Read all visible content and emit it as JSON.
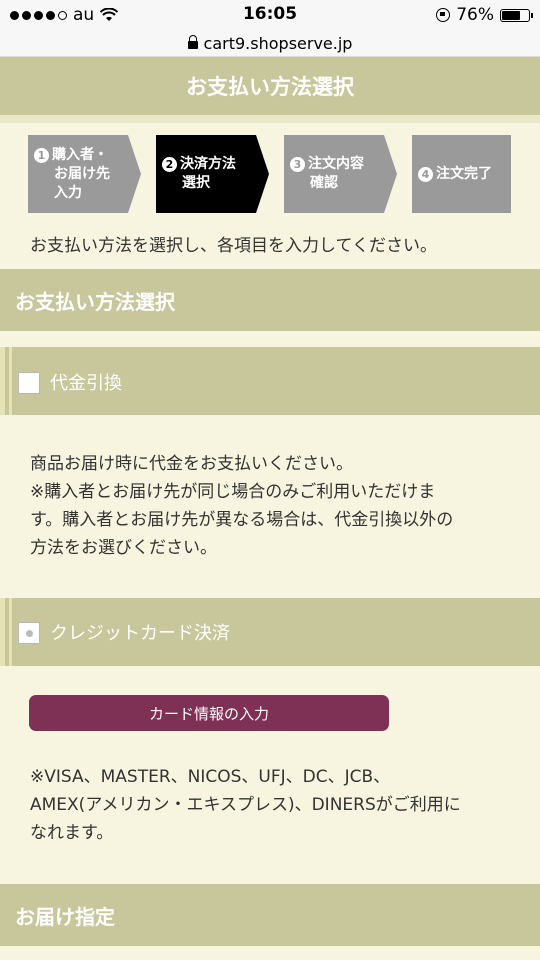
{
  "status": {
    "carrier": "au",
    "time": "16:05",
    "battery": "76%",
    "battery_level": 0.76
  },
  "browser": {
    "url": "cart9.shopserve.jp"
  },
  "page": {
    "title": "お支払い方法選択",
    "intro": "お支払い方法を選択し、各項目を入力してください。"
  },
  "steps": [
    {
      "num": "1",
      "lines": [
        "購入者・",
        "お届け先",
        "入力"
      ]
    },
    {
      "num": "2",
      "lines": [
        "決済方法",
        "選択"
      ]
    },
    {
      "num": "3",
      "lines": [
        "注文内容",
        "確認"
      ]
    },
    {
      "num": "4",
      "lines": [
        "注文完了"
      ]
    }
  ],
  "payment_section": {
    "heading": "お支払い方法選択",
    "cod": {
      "label": "代金引換",
      "lines": [
        "商品お届け時に代金をお支払いください。",
        "※購入者とお届け先が同じ場合のみご利用いただけま",
        "す。購入者とお届け先が異なる場合は、代金引換以外の",
        "方法をお選びください。"
      ]
    },
    "credit": {
      "label": "クレジットカード決済",
      "button": "カード情報の入力",
      "lines": [
        "※VISA、MASTER、NICOS、UFJ、DC、JCB、",
        "AMEX(アメリカン・エキスプレス)、DINERSがご利用に",
        "なれます。"
      ]
    }
  },
  "delivery_section": {
    "heading": "お届け指定"
  }
}
